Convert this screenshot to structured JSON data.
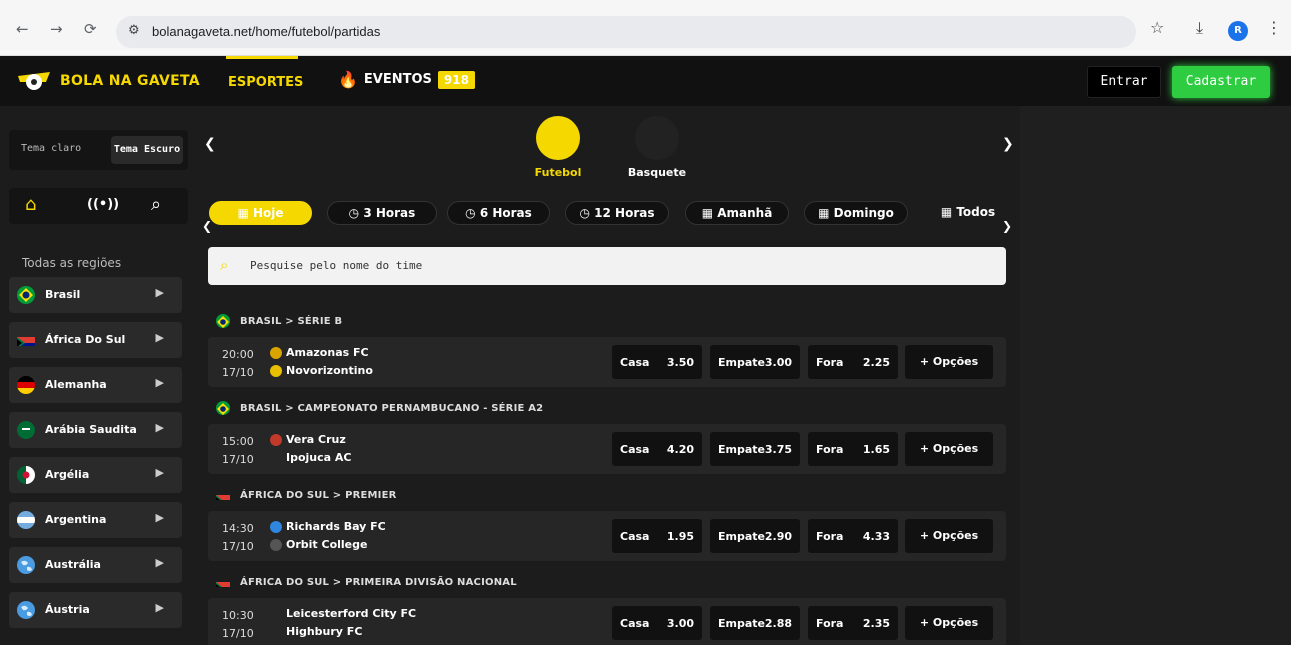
{
  "browser": {
    "url": "bolanagaveta.net/home/futebol/partidas",
    "profile_initial": "R"
  },
  "header": {
    "logo_text": "BOLA NA GAVETA",
    "tab_esportes": "ESPORTES",
    "eventos_label": "EVENTOS",
    "eventos_count": "918",
    "entrar": "Entrar",
    "cadastrar": "Cadastrar"
  },
  "sidebar": {
    "theme_light": "Tema claro",
    "theme_dark": "Tema Escuro",
    "regions_title": "Todas as regiões",
    "regions": [
      {
        "name": "Brasil"
      },
      {
        "name": "África Do Sul"
      },
      {
        "name": "Alemanha"
      },
      {
        "name": "Arábia Saudita"
      },
      {
        "name": "Argélia"
      },
      {
        "name": "Argentina"
      },
      {
        "name": "Austrália"
      },
      {
        "name": "Áustria"
      }
    ]
  },
  "sports": [
    {
      "label": "Futebol",
      "color": "#f5d800"
    },
    {
      "label": "Basquete",
      "color": "#222222"
    }
  ],
  "filters": [
    "Hoje",
    "3 Horas",
    "6 Horas",
    "12 Horas",
    "Amanhã",
    "Domingo",
    "Todos"
  ],
  "search": {
    "placeholder": "Pesquise pelo nome do time"
  },
  "odds_labels": {
    "home": "Casa",
    "draw": "Empate",
    "away": "Fora",
    "more": "+ Opções"
  },
  "leagues": [
    {
      "name": "BRASIL > SÉRIE B",
      "match": {
        "time": "20:00",
        "date": "17/10",
        "home": "Amazonas FC",
        "away": "Novorizontino",
        "casa": "3.50",
        "empate": "3.00",
        "fora": "2.25"
      }
    },
    {
      "name": "BRASIL > CAMPEONATO PERNAMBUCANO - SÉRIE A2",
      "match": {
        "time": "15:00",
        "date": "17/10",
        "home": "Vera Cruz",
        "away": "Ipojuca AC",
        "casa": "4.20",
        "empate": "3.75",
        "fora": "1.65"
      }
    },
    {
      "name": "ÁFRICA DO SUL > PREMIER",
      "match": {
        "time": "14:30",
        "date": "17/10",
        "home": "Richards Bay FC",
        "away": "Orbit College",
        "casa": "1.95",
        "empate": "2.90",
        "fora": "4.33"
      }
    },
    {
      "name": "ÁFRICA DO SUL > PRIMEIRA DIVISÃO NACIONAL",
      "match": {
        "time": "10:30",
        "date": "17/10",
        "home": "Leicesterford City FC",
        "away": "Highbury FC",
        "casa": "3.00",
        "empate": "2.88",
        "fora": "2.35"
      }
    }
  ],
  "colors": {
    "accent": "#f5d800",
    "success": "#2ecc40",
    "bg": "#1c1c1c"
  }
}
